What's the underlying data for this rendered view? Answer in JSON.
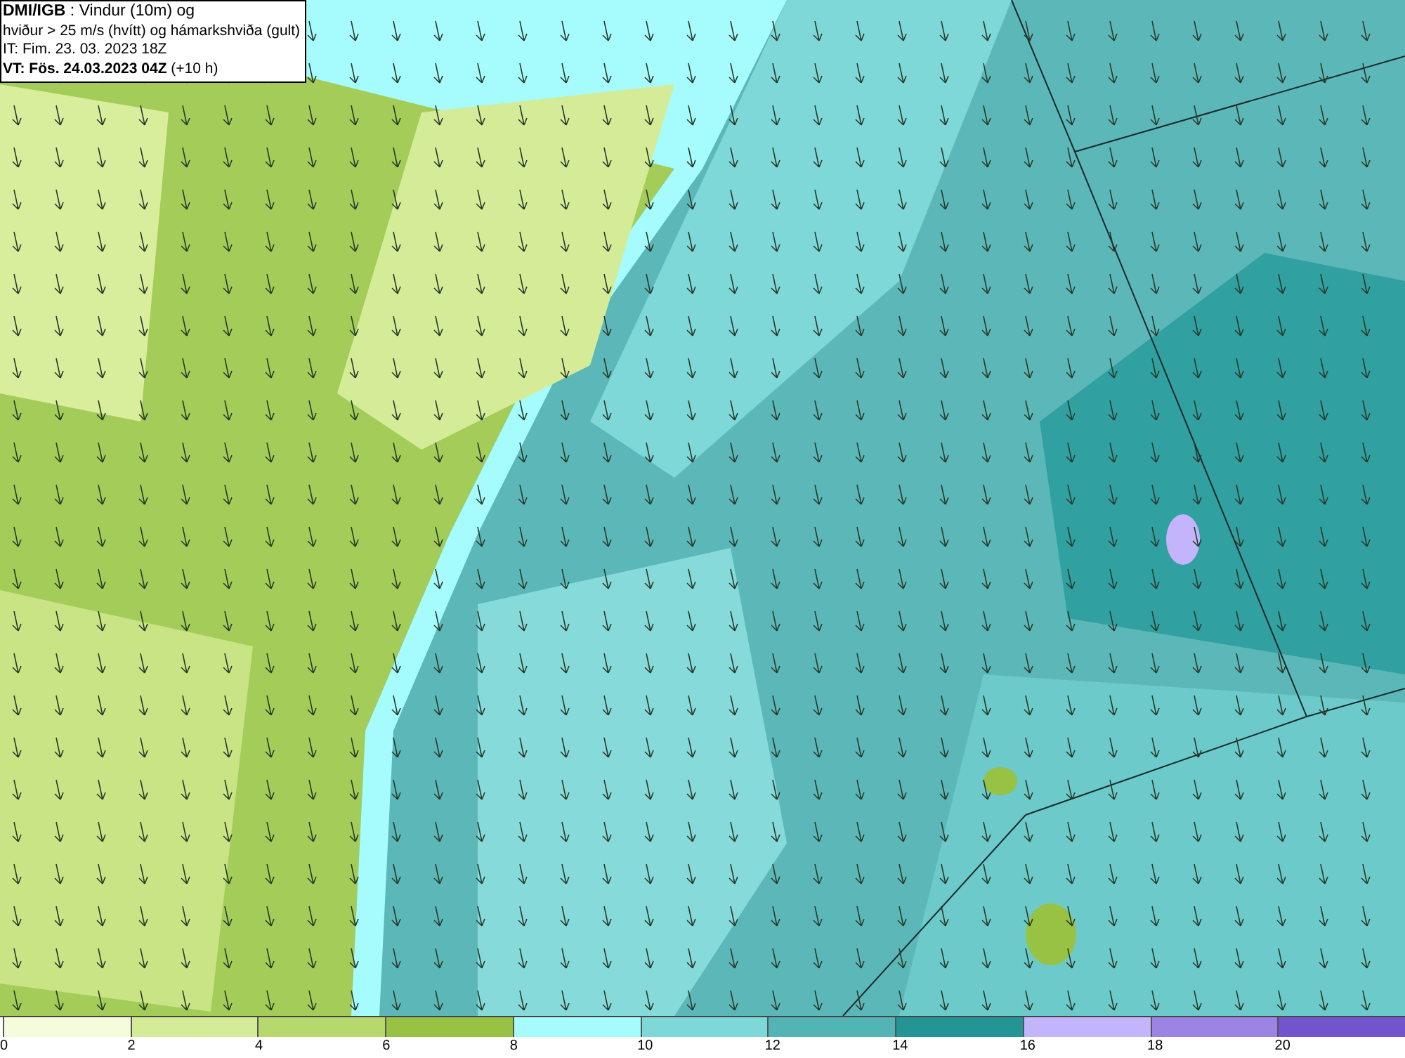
{
  "title_box": {
    "lines": [
      "**DMI/IGB** : Vindur (10m) og",
      "hviður > 25 m/s (hvítt) og hámarkshviða (gult)",
      "IT: Fim. 23. 03. 2023 18Z",
      "**VT: Fös. 24.03.2023 04Z** (+10 h)"
    ]
  },
  "legend": [
    {
      "label": "0",
      "color": "#f4fcdc"
    },
    {
      "label": "2",
      "color": "#d4ec98"
    },
    {
      "label": "4",
      "color": "#b6d86c"
    },
    {
      "label": "6",
      "color": "#98c244"
    },
    {
      "label": "8",
      "color": "#a6fcfc"
    },
    {
      "label": "10",
      "color": "#7ed8d8"
    },
    {
      "label": "12",
      "color": "#52b4b4"
    },
    {
      "label": "14",
      "color": "#249494"
    },
    {
      "label": "16",
      "color": "#c4b4fc"
    },
    {
      "label": "18",
      "color": "#9c84e4"
    },
    {
      "label": "20",
      "color": "#7454cc"
    }
  ]
}
